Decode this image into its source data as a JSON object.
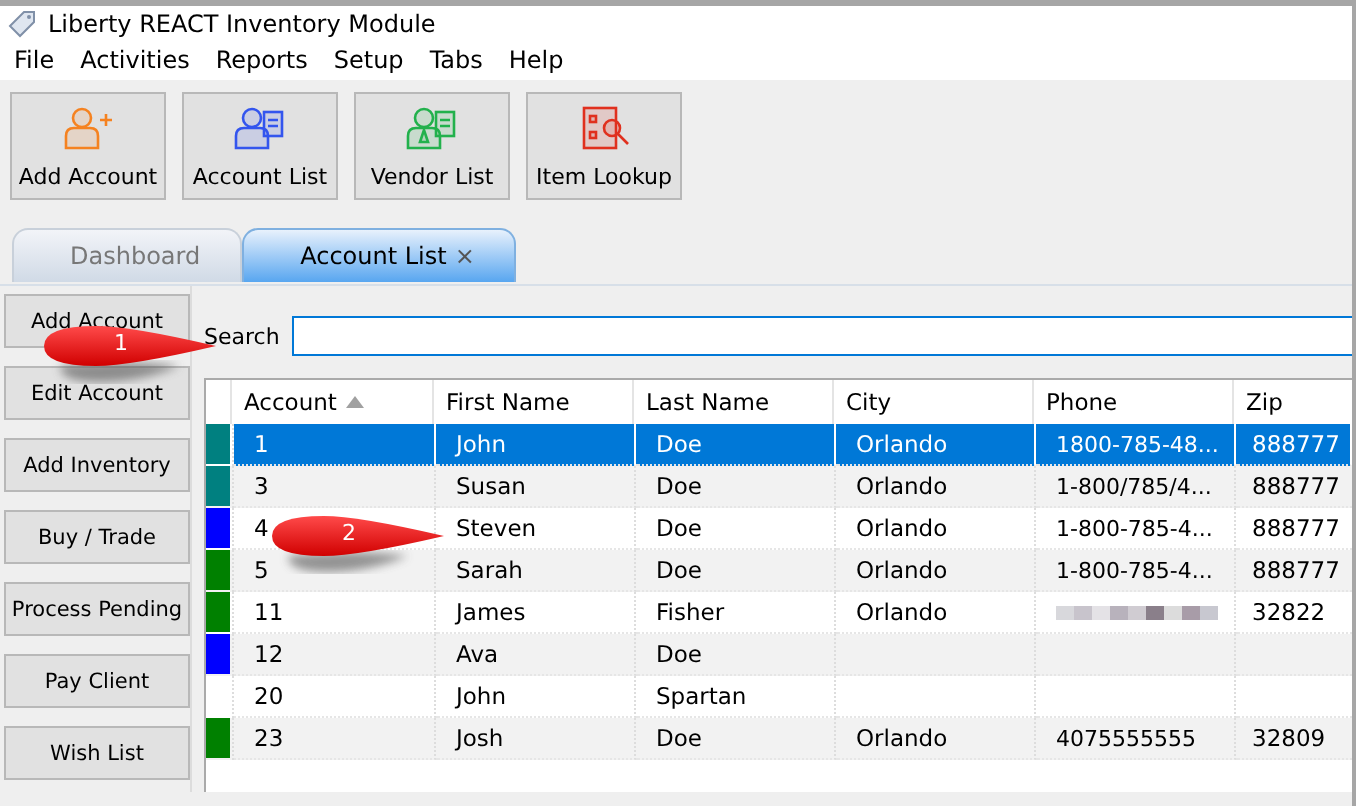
{
  "window": {
    "title": "Liberty REACT Inventory Module"
  },
  "menu": [
    "File",
    "Activities",
    "Reports",
    "Setup",
    "Tabs",
    "Help"
  ],
  "toolbar": [
    {
      "label": "Add Account",
      "kind": "add-person"
    },
    {
      "label": "Account List",
      "kind": "person-list"
    },
    {
      "label": "Vendor List",
      "kind": "vendor"
    },
    {
      "label": "Item Lookup",
      "kind": "lookup"
    }
  ],
  "tabs": [
    {
      "label": "Dashboard",
      "selected": false
    },
    {
      "label": "Account List",
      "selected": true,
      "close": "×"
    }
  ],
  "side_buttons": [
    "Add Account",
    "Edit Account",
    "Add Inventory",
    "Buy / Trade",
    "Process Pending",
    "Pay Client",
    "Wish List"
  ],
  "search": {
    "label": "Search"
  },
  "table": {
    "columns": [
      {
        "label": "Account",
        "sorted": true
      },
      {
        "label": "First Name"
      },
      {
        "label": "Last Name"
      },
      {
        "label": "City"
      },
      {
        "label": "Phone"
      },
      {
        "label": "Zip"
      }
    ],
    "rows": [
      {
        "color": "#008080",
        "selected": true,
        "cells": [
          "1",
          "John",
          "Doe",
          "Orlando",
          "1800-785-48...",
          "888777"
        ]
      },
      {
        "color": "#008080",
        "selected": false,
        "cells": [
          "3",
          "Susan",
          "Doe",
          "Orlando",
          "1-800/785/4...",
          "888777"
        ]
      },
      {
        "color": "#0000ff",
        "selected": false,
        "cells": [
          "4",
          "Steven",
          "Doe",
          "Orlando",
          "1-800-785-4...",
          "888777"
        ]
      },
      {
        "color": "#008000",
        "selected": false,
        "cells": [
          "5",
          "Sarah",
          "Doe",
          "Orlando",
          "1-800-785-4...",
          "888777"
        ]
      },
      {
        "color": "#008000",
        "selected": false,
        "cells": [
          "11",
          "James",
          "Fisher",
          "Orlando",
          null,
          "32822"
        ]
      },
      {
        "color": "#0000ff",
        "selected": false,
        "cells": [
          "12",
          "Ava",
          "Doe",
          "",
          "",
          ""
        ]
      },
      {
        "selected": false,
        "cells": [
          "20",
          "John",
          "Spartan",
          "",
          "",
          ""
        ]
      },
      {
        "color": "#008000",
        "selected": false,
        "cells": [
          "23",
          "Josh",
          "Doe",
          "Orlando",
          "4075555555",
          "32809"
        ]
      }
    ]
  },
  "callouts": [
    {
      "label": "1"
    },
    {
      "label": "2"
    }
  ]
}
